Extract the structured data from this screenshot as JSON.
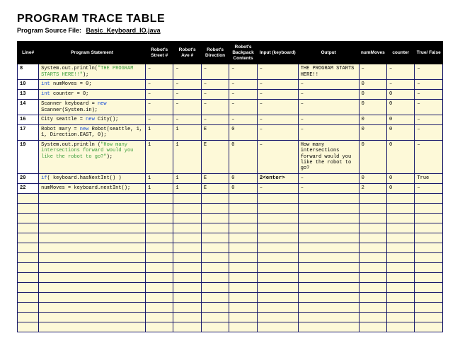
{
  "title": "PROGRAM TRACE TABLE",
  "subtitle_label": "Program Source File:",
  "source_file": " Basic_Keyboard_IO.java",
  "headers": {
    "line": "Line#",
    "stmt": "Program Statement",
    "street": "Robot's\nStreet #",
    "ave": "Robot's\nAve #",
    "dir": "Robot's\nDirection",
    "bp": "Robot's\nBackpack\nContents",
    "input": "Input\n(keyboard)",
    "output": "Output",
    "nm": "numMoves",
    "ctr": "counter",
    "tf": "True/\nFalse"
  },
  "rows": [
    {
      "line": "8",
      "stmt_html": "System.out.println(<span class='str-green'>\"THE PROGRAM STARTS HERE!!\"</span>);",
      "street": "–",
      "ave": "–",
      "dir": "–",
      "bp": "–",
      "input": "–",
      "output": "THE PROGRAM STARTS HERE!!",
      "nm": "–",
      "ctr": "–",
      "tf": "–"
    },
    {
      "line": "10",
      "stmt_html": "<span class='kw-blue'>int</span> numMoves = 0;",
      "street": "–",
      "ave": "–",
      "dir": "–",
      "bp": "–",
      "input": "–",
      "output": "–",
      "nm": "0",
      "ctr": "–",
      "tf": "–"
    },
    {
      "line": "13",
      "stmt_html": "<span class='kw-blue'>int</span> counter = 0;",
      "street": "–",
      "ave": "–",
      "dir": "–",
      "bp": "–",
      "input": "–",
      "output": "–",
      "nm": "0",
      "ctr": "0",
      "tf": "–"
    },
    {
      "line": "14",
      "stmt_html": "Scanner keyboard = <span class='kw-blue'>new</span> Scanner(System.in);",
      "street": "–",
      "ave": "–",
      "dir": "–",
      "bp": "–",
      "input": "–",
      "output": "–",
      "nm": "0",
      "ctr": "0",
      "tf": "–"
    },
    {
      "line": "16",
      "stmt_html": "City seattle = <span class='kw-blue'>new</span> City();",
      "street": "–",
      "ave": "–",
      "dir": "–",
      "bp": "–",
      "input": "–",
      "output": "–",
      "nm": "0",
      "ctr": "0",
      "tf": "–"
    },
    {
      "line": "17",
      "stmt_html": "Robot mary = <span class='kw-blue'>new</span> Robot(seattle, 1, 1, Direction.EAST, 0);",
      "street": "1",
      "ave": "1",
      "dir": "E",
      "bp": "0",
      "input": "–",
      "output": "–",
      "nm": "0",
      "ctr": "0",
      "tf": "–"
    },
    {
      "line": "19",
      "stmt_html": "System.out.println (<span class='str-green'>\"How many intersections forward would you like the robot to go?\"</span>);",
      "street": "1",
      "ave": "1",
      "dir": "E",
      "bp": "0",
      "input": "–",
      "output": "How many intersections forward would you like the robot to go?",
      "nm": "0",
      "ctr": "0",
      "tf": "–"
    },
    {
      "line": "20",
      "stmt_html": "<span class='kw-blue'>if</span>( keyboard.hasNextInt() )",
      "street": "1",
      "ave": "1",
      "dir": "E",
      "bp": "0",
      "input_html": "<span class='input-bold'>2&lt;enter&gt;</span>",
      "output": "–",
      "nm": "0",
      "ctr": "0",
      "tf": "True"
    },
    {
      "line": "22",
      "stmt_html": "numMoves = keyboard.nextInt();",
      "street": "1",
      "ave": "1",
      "dir": "E",
      "bp": "0",
      "input": "–",
      "output": "–",
      "nm": "2",
      "ctr": "0",
      "tf": "–"
    }
  ],
  "empty_rows": 14
}
